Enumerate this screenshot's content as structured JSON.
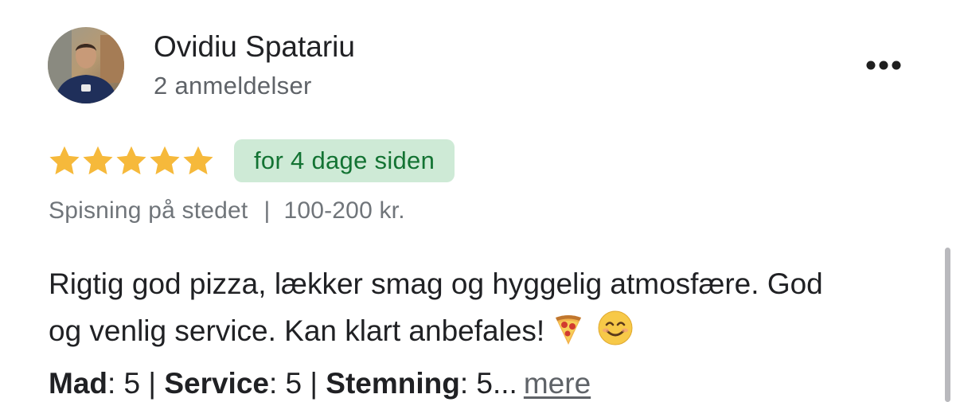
{
  "review": {
    "author_name": "Ovidiu Spatariu",
    "author_reviews": "2 anmeldelser",
    "rating": 5,
    "rating_max": 5,
    "time_ago": "for 4 dage siden",
    "meta": {
      "service_type": "Spisning på stedet",
      "separator": "|",
      "price_range": "100-200 kr."
    },
    "text_line1": "Rigtig god pizza, lækker smag og hyggelig atmosfære. God",
    "text_line2": "og venlig service. Kan klart anbefales!",
    "ratings": {
      "mad_label": "Mad",
      "mad_value": ": 5 | ",
      "service_label": "Service",
      "service_value": ": 5 | ",
      "stemning_label": "Stemning",
      "stemning_value": ": 5..."
    },
    "more_label": "mere"
  },
  "icons": {
    "star": "star-icon",
    "menu": "more-horizontal-icon",
    "pizza": "pizza-emoji-icon",
    "smile": "smiling-face-emoji-icon"
  },
  "colors": {
    "star": "#f4b400",
    "badge_bg": "#ceead6",
    "badge_text": "#137333"
  }
}
